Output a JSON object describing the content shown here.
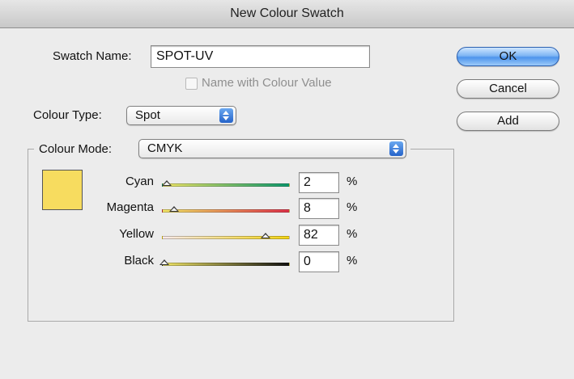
{
  "window": {
    "title": "New Colour Swatch"
  },
  "swatch_name": {
    "label": "Swatch Name:",
    "value": "SPOT-UV"
  },
  "name_with_value": {
    "label": "Name with Colour Value",
    "checked": false,
    "enabled": false
  },
  "colour_type": {
    "label": "Colour Type:",
    "selected": "Spot"
  },
  "colour_mode": {
    "label": "Colour Mode:",
    "selected": "CMYK"
  },
  "buttons": {
    "ok": "OK",
    "cancel": "Cancel",
    "add": "Add"
  },
  "preview": {
    "color": "#f7dc5f"
  },
  "sliders": [
    {
      "name": "cyan",
      "label": "Cyan",
      "value": "2",
      "unit": "%",
      "fraction": 0.02,
      "gradient": [
        "#f2e768",
        "#0e9b6e"
      ]
    },
    {
      "name": "magenta",
      "label": "Magenta",
      "value": "8",
      "unit": "%",
      "fraction": 0.08,
      "gradient": [
        "#f2e768",
        "#e0334a"
      ]
    },
    {
      "name": "yellow",
      "label": "Yellow",
      "value": "82",
      "unit": "%",
      "fraction": 0.82,
      "gradient": [
        "#f8e9ea",
        "#f4d514"
      ]
    },
    {
      "name": "black",
      "label": "Black",
      "value": "0",
      "unit": "%",
      "fraction": 0.0,
      "gradient": [
        "#f2e768",
        "#111111"
      ]
    }
  ]
}
